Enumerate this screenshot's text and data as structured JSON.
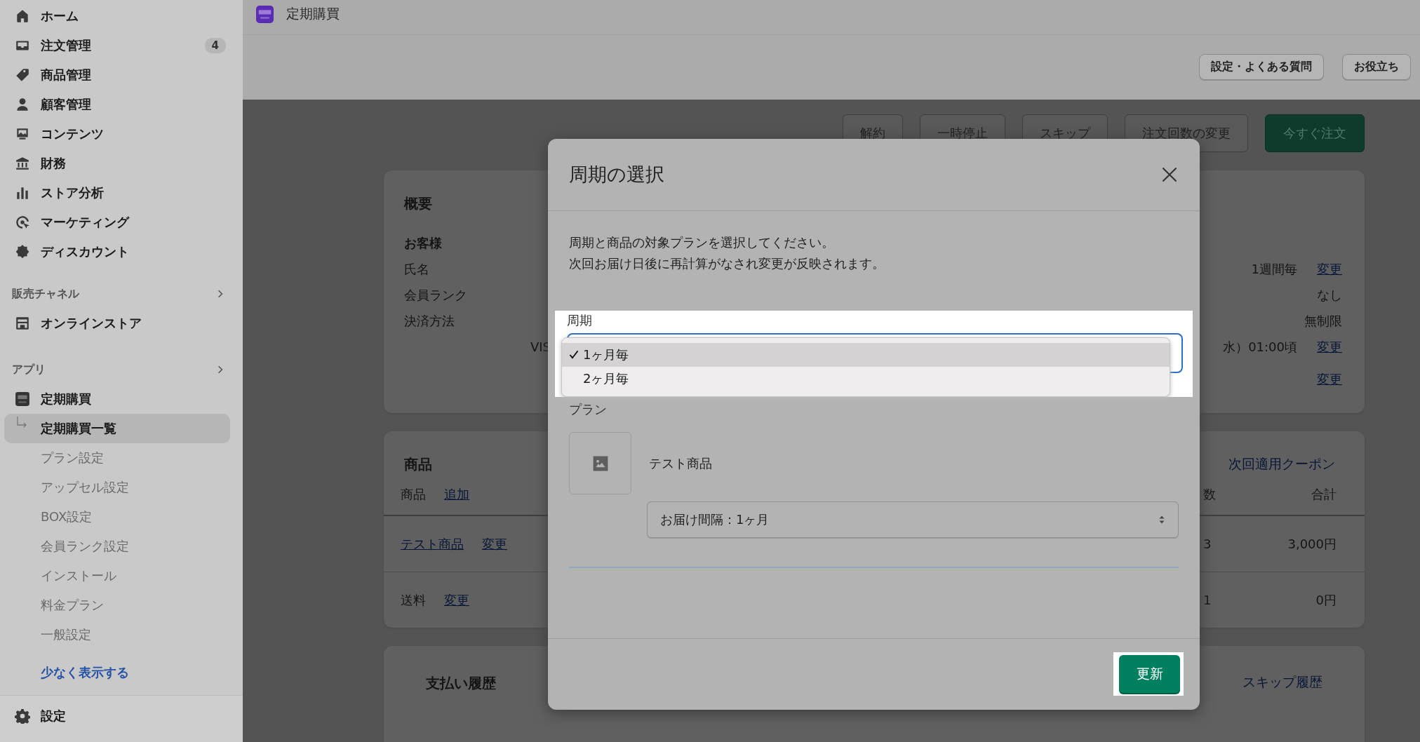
{
  "sidebar": {
    "items": [
      {
        "label": "ホーム"
      },
      {
        "label": "注文管理",
        "badge": "4"
      },
      {
        "label": "商品管理"
      },
      {
        "label": "顧客管理"
      },
      {
        "label": "コンテンツ"
      },
      {
        "label": "財務"
      },
      {
        "label": "ストア分析"
      },
      {
        "label": "マーケティング"
      },
      {
        "label": "ディスカウント"
      }
    ],
    "sales_channels": {
      "title": "販売チャネル",
      "items": [
        {
          "label": "オンラインストア"
        }
      ]
    },
    "apps": {
      "title": "アプリ",
      "app": {
        "label": "定期購買",
        "children": [
          {
            "label": "定期購買一覧",
            "selected": true
          },
          {
            "label": "プラン設定",
            "selected": false
          },
          {
            "label": "アップセル設定",
            "selected": false
          },
          {
            "label": "BOX設定",
            "selected": false
          },
          {
            "label": "会員ランク設定",
            "selected": false
          },
          {
            "label": "インストール",
            "selected": false
          },
          {
            "label": "料金プラン",
            "selected": false
          },
          {
            "label": "一般設定",
            "selected": false
          }
        ]
      }
    },
    "show_less": "少なく表示する",
    "settings": "設定"
  },
  "app_header": {
    "title": "定期購買",
    "buttons": [
      "設定・よくある質問",
      "お役立ち"
    ]
  },
  "actions": [
    {
      "label": "解約",
      "kind": "secondary"
    },
    {
      "label": "一時停止",
      "kind": "secondary"
    },
    {
      "label": "スキップ",
      "kind": "secondary"
    },
    {
      "label": "注文回数の変更",
      "kind": "secondary"
    },
    {
      "label": "今すぐ注文",
      "kind": "primary"
    }
  ],
  "summary": {
    "title": "概要",
    "rows": [
      {
        "label": "お客様",
        "kind": "heading"
      },
      {
        "label": "氏名",
        "value": "1週間毎",
        "link": "変更"
      },
      {
        "label": "会員ランク",
        "value": "なし"
      },
      {
        "label": "決済方法",
        "value": "無制限"
      },
      {
        "detail": "VIS",
        "value": "水）01:00頃",
        "link": "変更"
      },
      {
        "link": "変更"
      }
    ]
  },
  "products": {
    "title": "商品",
    "coupon_link": "次回適用クーポン",
    "header": {
      "label": "商品",
      "link": "追加",
      "qty": "数",
      "total": "合計"
    },
    "rows": [
      {
        "label": "テスト商品",
        "label_is_link": true,
        "link": "変更",
        "qty": "3",
        "total": "3,000円"
      },
      {
        "label": "送料",
        "label_is_link": false,
        "link": "変更",
        "qty": "1",
        "total": "0円"
      }
    ]
  },
  "payments": {
    "title": "支払い履歴",
    "link": "スキップ履歴"
  },
  "modal": {
    "title": "周期の選択",
    "description": [
      "周期と商品の対象プランを選択してください。",
      "次回お届け日後に再計算がなされ変更が反映されます。"
    ],
    "cycle": {
      "label": "周期",
      "options": [
        {
          "label": "1ヶ月毎",
          "selected": true
        },
        {
          "label": "2ヶ月毎",
          "selected": false
        }
      ]
    },
    "plan": {
      "label": "プラン",
      "product": "テスト商品",
      "select_value": "お届け間隔：1ヶ月"
    },
    "submit": "更新"
  }
}
